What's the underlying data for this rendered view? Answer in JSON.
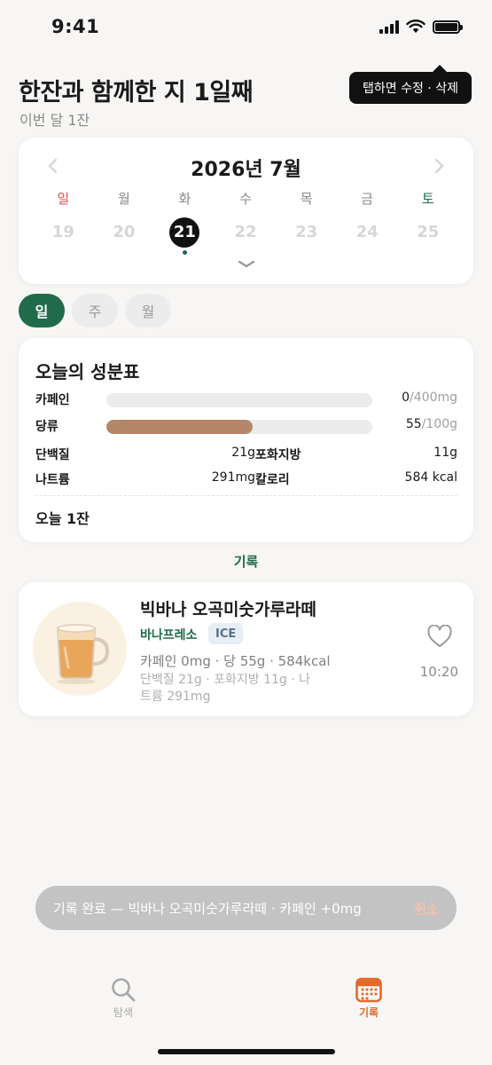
{
  "status_bar": {
    "time": "9:41"
  },
  "header": {
    "title": "한잔과 함께한 지 1일째",
    "subtitle": "이번 달 1잔"
  },
  "tooltip": {
    "text": "탭하면 수정 · 삭제"
  },
  "calendar": {
    "month_label": "2026년 7월",
    "prev_icon": "chevron-left-icon",
    "next_icon": "chevron-right-icon",
    "weekdays": [
      "일",
      "월",
      "화",
      "수",
      "목",
      "금",
      "토"
    ],
    "dates": [
      "19",
      "20",
      "21",
      "22",
      "23",
      "24",
      "25"
    ],
    "selected_date": "21",
    "expand_icon": "chevron-down-icon"
  },
  "period_tabs": [
    "일",
    "주",
    "월"
  ],
  "nutrition": {
    "title": "오늘의 성분표",
    "caffeine": {
      "label": "카페인",
      "value": "0",
      "max": "/400mg",
      "fraction": 0
    },
    "sugar": {
      "label": "당류",
      "value": "55",
      "max": "/100g",
      "fraction": 0.55
    },
    "protein": {
      "label": "단백질",
      "value": "21g"
    },
    "sat_fat": {
      "label": "포화지방",
      "value": "11g"
    },
    "sodium": {
      "label": "나트륨",
      "value": "291mg"
    },
    "calories": {
      "label": "칼로리",
      "value": "584 kcal"
    },
    "total": "오늘 1잔"
  },
  "records": {
    "section_label": "기록",
    "items": [
      {
        "name": "빅바나 오곡미숫가루라떼",
        "brand": "바나프레소",
        "badge": "ICE",
        "line1": "카페인 0mg · 당 55g · 584kcal",
        "line2": "단백질 21g · 포화지방 11g · 나트륨 291mg",
        "time": "10:20",
        "favorite_icon": "heart-outline-icon"
      }
    ]
  },
  "toast": {
    "message": "기록 완료 — 빅바나 오곡미숫가루라떼 · 카페인 +0mg",
    "undo": "취소"
  },
  "tab_bar": {
    "search": {
      "label": "탐색",
      "icon": "search-icon"
    },
    "record": {
      "label": "기록",
      "icon": "calendar-icon"
    }
  },
  "colors": {
    "accent": "#1f6b4a",
    "sugar_bar": "#b4876b",
    "active_tab": "#e26a2c",
    "sunday": "#d9534f"
  }
}
